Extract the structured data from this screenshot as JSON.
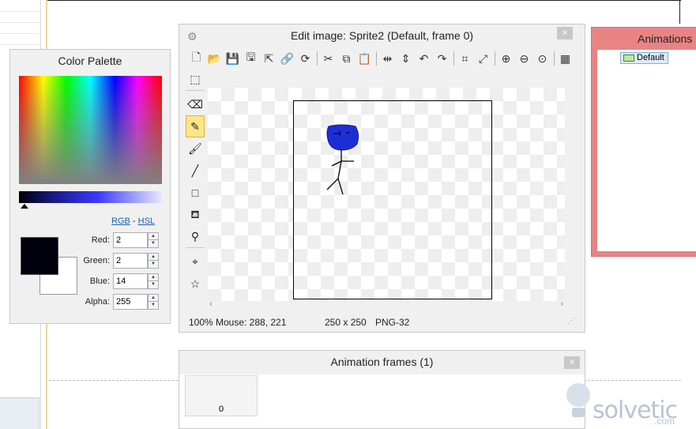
{
  "color_palette": {
    "title": "Color Palette",
    "mode_links": {
      "rgb": "RGB",
      "separator": "-",
      "hsl": "HSL"
    },
    "fields": [
      {
        "label": "Red:",
        "value": "2"
      },
      {
        "label": "Green:",
        "value": "2"
      },
      {
        "label": "Blue:",
        "value": "14"
      },
      {
        "label": "Alpha:",
        "value": "255"
      }
    ],
    "primary_color": "#02020e",
    "secondary_color": "#ffffff"
  },
  "edit_image": {
    "title": "Edit image: Sprite2 (Default, frame 0)",
    "close": "×",
    "status": {
      "zoom": "100%",
      "mouse": "Mouse: 288, 221",
      "size": "250 x 250",
      "format": "PNG-32"
    },
    "sprite_color": "#1c2fd4"
  },
  "animations": {
    "title": "Animations",
    "items": [
      {
        "label": "Default"
      }
    ]
  },
  "frames": {
    "title": "Animation frames (1)",
    "close": "×",
    "items": [
      {
        "label": "0"
      }
    ]
  },
  "watermark": {
    "text": "solvetic",
    "suffix": ".com"
  }
}
